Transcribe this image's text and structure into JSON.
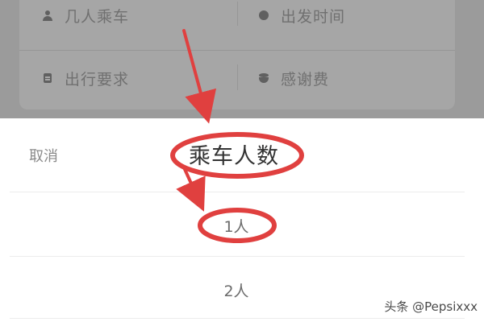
{
  "form": {
    "fields": [
      {
        "label": "几人乘车",
        "icon": "person-icon"
      },
      {
        "label": "出发时间",
        "icon": "clock-icon"
      },
      {
        "label": "出行要求",
        "icon": "note-icon"
      },
      {
        "label": "感谢费",
        "icon": "coins-icon"
      }
    ]
  },
  "picker": {
    "cancel_label": "取消",
    "title": "乘车人数",
    "options": [
      "1人",
      "2人"
    ]
  },
  "watermark": "头条 @Pepsixxx",
  "colors": {
    "annotation": "#e0403f",
    "backdrop": "#9b9b9b",
    "sheet": "#ffffff"
  }
}
